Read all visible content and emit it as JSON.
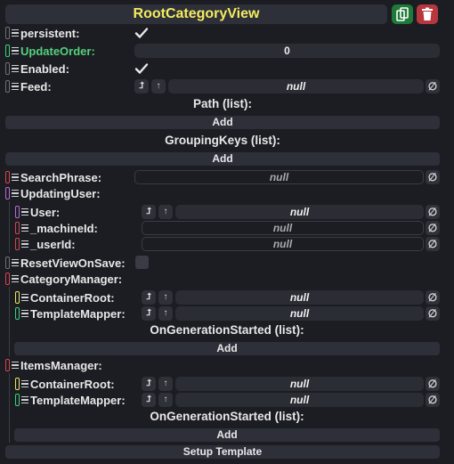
{
  "header": {
    "title": "RootCategoryView"
  },
  "fields": {
    "persistent": "persistent:",
    "update_order": "UpdateOrder:",
    "update_order_value": "0",
    "enabled": "Enabled:",
    "feed": "Feed:",
    "feed_value": "null",
    "path_list": "Path (list):",
    "grouping_keys_list": "GroupingKeys (list):",
    "search_phrase": "SearchPhrase:",
    "search_phrase_value": "null",
    "updating_user": "UpdatingUser:",
    "user": "User:",
    "user_value": "null",
    "machine_id": "_machineId:",
    "machine_id_value": "null",
    "user_id": "_userId:",
    "user_id_value": "null",
    "reset_view_on_save": "ResetViewOnSave:",
    "category_manager": "CategoryManager:",
    "cm_container_root": "ContainerRoot:",
    "cm_container_root_value": "null",
    "cm_template_mapper": "TemplateMapper:",
    "cm_template_mapper_value": "null",
    "cm_on_generation_started": "OnGenerationStarted (list):",
    "items_manager": "ItemsManager:",
    "im_container_root": "ContainerRoot:",
    "im_container_root_value": "null",
    "im_template_mapper": "TemplateMapper:",
    "im_template_mapper_value": "null",
    "im_on_generation_started": "OnGenerationStarted (list):"
  },
  "buttons": {
    "add": "Add",
    "setup_template": "Setup Template",
    "null_symbol": "∅",
    "jump_symbol": "⮥",
    "up_symbol": "↑"
  },
  "colors": {
    "title": "#f4ec5f",
    "green": "#3bd07a",
    "red": "#d34651",
    "purple": "#b66ad9",
    "yellow": "#e9e562",
    "gray": "#6e7078"
  },
  "icons": {
    "duplicate": "duplicate-icon",
    "trash": "trash-icon",
    "drag": "drag-handle-icon",
    "check": "checkmark-icon"
  }
}
